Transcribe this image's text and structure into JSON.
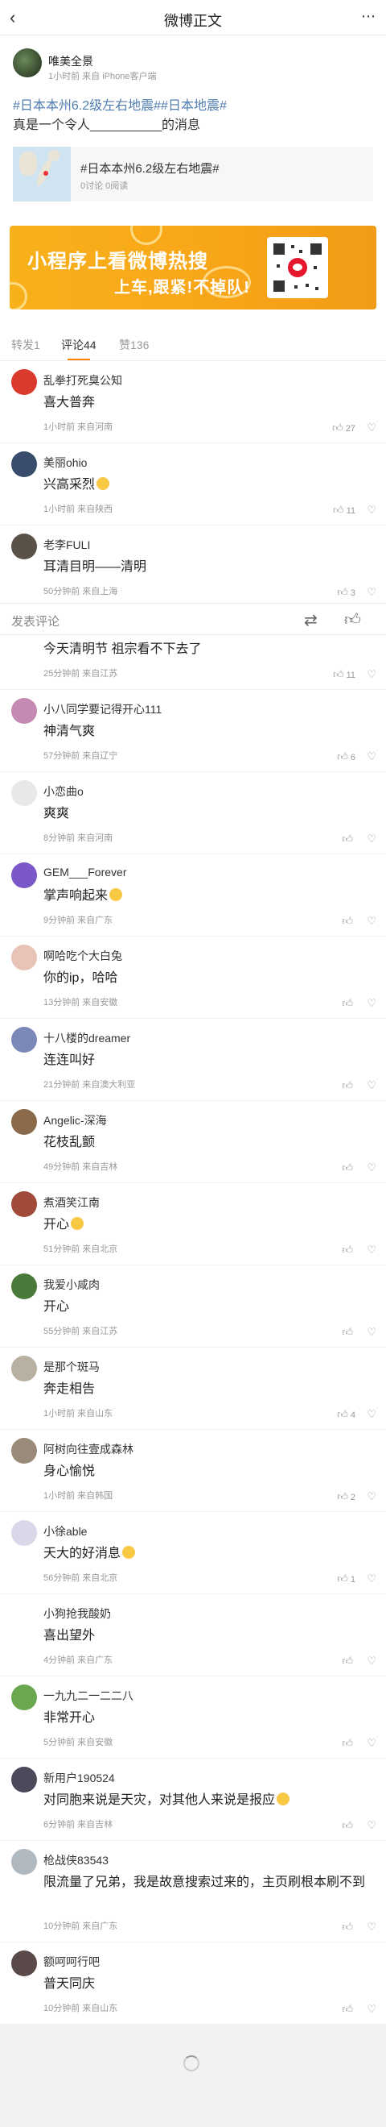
{
  "navbar": {
    "title": "微博正文",
    "back_icon": "chevron-left-icon",
    "more_icon": "more-dots-icon"
  },
  "post": {
    "author": "唯美全景",
    "meta": "1小时前 来自 iPhone客户端",
    "topic_1": "#日本本州6.2级左右地震#",
    "topic_2": "#日本地震#",
    "text": "真是一个令人__________的消息",
    "card_title": "#日本本州6.2级左右地震#",
    "card_stats": "0讨论 0阅读"
  },
  "banner": {
    "line1": "小程序上看微博热搜",
    "line2": "上车,跟紧!不掉队!"
  },
  "tabs": [
    {
      "label": "转发1"
    },
    {
      "label": "评论44",
      "active": true
    },
    {
      "label": "赞136"
    }
  ],
  "reply_bar": {
    "placeholder": "发表评论",
    "repost_icon": "repost-icon",
    "like_icon": "like-icon"
  },
  "comments": [
    {
      "name": "乱拳打死臭公知",
      "text": "喜大普奔",
      "meta": "1小时前 来自河南",
      "likes": "27",
      "avatar": "#d93a2b"
    },
    {
      "name": "美丽ohio",
      "text": "兴高采烈",
      "emoji": true,
      "meta": "1小时前 来自陕西",
      "likes": "11",
      "avatar": "#3a4c6b"
    },
    {
      "name": "老李FULI",
      "text": "耳清目明——清明",
      "meta": "50分钟前 来自上海",
      "likes": "3",
      "avatar": "#5a5147"
    },
    {
      "name": "",
      "text": "今天清明节 祖宗看不下去了",
      "meta": "25分钟前 来自江苏",
      "likes": "11",
      "avatar": ""
    },
    {
      "name": "小八同学要记得开心111",
      "text": "神清气爽",
      "meta": "57分钟前 来自辽宁",
      "likes": "6",
      "avatar": "#c48ab1"
    },
    {
      "name": "小恋曲o",
      "text": "爽爽",
      "meta": "8分钟前 来自河南",
      "likes": "",
      "avatar": "#e8e8e8"
    },
    {
      "name": "GEM___Forever",
      "text": "掌声响起来",
      "emoji": true,
      "meta": "9分钟前 来自广东",
      "likes": "",
      "avatar": "#7b58c8"
    },
    {
      "name": "啊哈吃个大白兔",
      "text": "你的ip，哈哈",
      "meta": "13分钟前 来自安徽",
      "likes": "",
      "avatar": "#e9c3b7"
    },
    {
      "name": "十八楼的dreamer",
      "text": "连连叫好",
      "meta": "21分钟前 来自澳大利亚",
      "likes": "",
      "avatar": "#7c88b8"
    },
    {
      "name": "Angelic-深海",
      "text": "花枝乱颤",
      "meta": "49分钟前 来自吉林",
      "likes": "",
      "avatar": "#8a6a4a"
    },
    {
      "name": "煮酒笑江南",
      "text": "开心",
      "emoji": true,
      "meta": "51分钟前 来自北京",
      "likes": "",
      "avatar": "#a04a3a"
    },
    {
      "name": "我爱小咸肉",
      "text": "开心",
      "meta": "55分钟前 来自江苏",
      "likes": "",
      "avatar": "#4a7a3a"
    },
    {
      "name": "是那个斑马",
      "text": "奔走相告",
      "meta": "1小时前 来自山东",
      "likes": "4",
      "avatar": "#b8b0a0"
    },
    {
      "name": "阿树向往壹成森林",
      "text": "身心愉悦",
      "meta": "1小时前 来自韩国",
      "likes": "2",
      "avatar": "#9a8a7a"
    },
    {
      "name": "小徐able",
      "text": "天大的好消息",
      "emoji": true,
      "meta": "56分钟前 来自北京",
      "likes": "1",
      "avatar": "#d8d8e8"
    },
    {
      "name": "小狗抢我酸奶",
      "text": "喜出望外",
      "meta": "4分钟前 来自广东",
      "likes": "",
      "avatar": "#ffffff"
    },
    {
      "name": "一九九二一二二八",
      "text": "非常开心",
      "meta": "5分钟前 来自安徽",
      "likes": "",
      "avatar": "#6aa84f"
    },
    {
      "name": "新用户190524",
      "text": "对同胞来说是天灾，对其他人来说是报应",
      "emoji": true,
      "meta": "6分钟前 来自吉林",
      "likes": "",
      "avatar": "#4a4a5a"
    },
    {
      "name": "枪战侠83543",
      "text": "限流量了兄弟，我是故意搜索过来的，主页刷根本刷不到",
      "meta": "10分钟前 来自广东",
      "likes": "",
      "avatar": "#b0b8c0",
      "tall": true
    },
    {
      "name": "额呵呵行吧",
      "text": "普天同庆",
      "meta": "10分钟前 来自山东",
      "likes": "",
      "avatar": "#5a4a4a"
    }
  ]
}
